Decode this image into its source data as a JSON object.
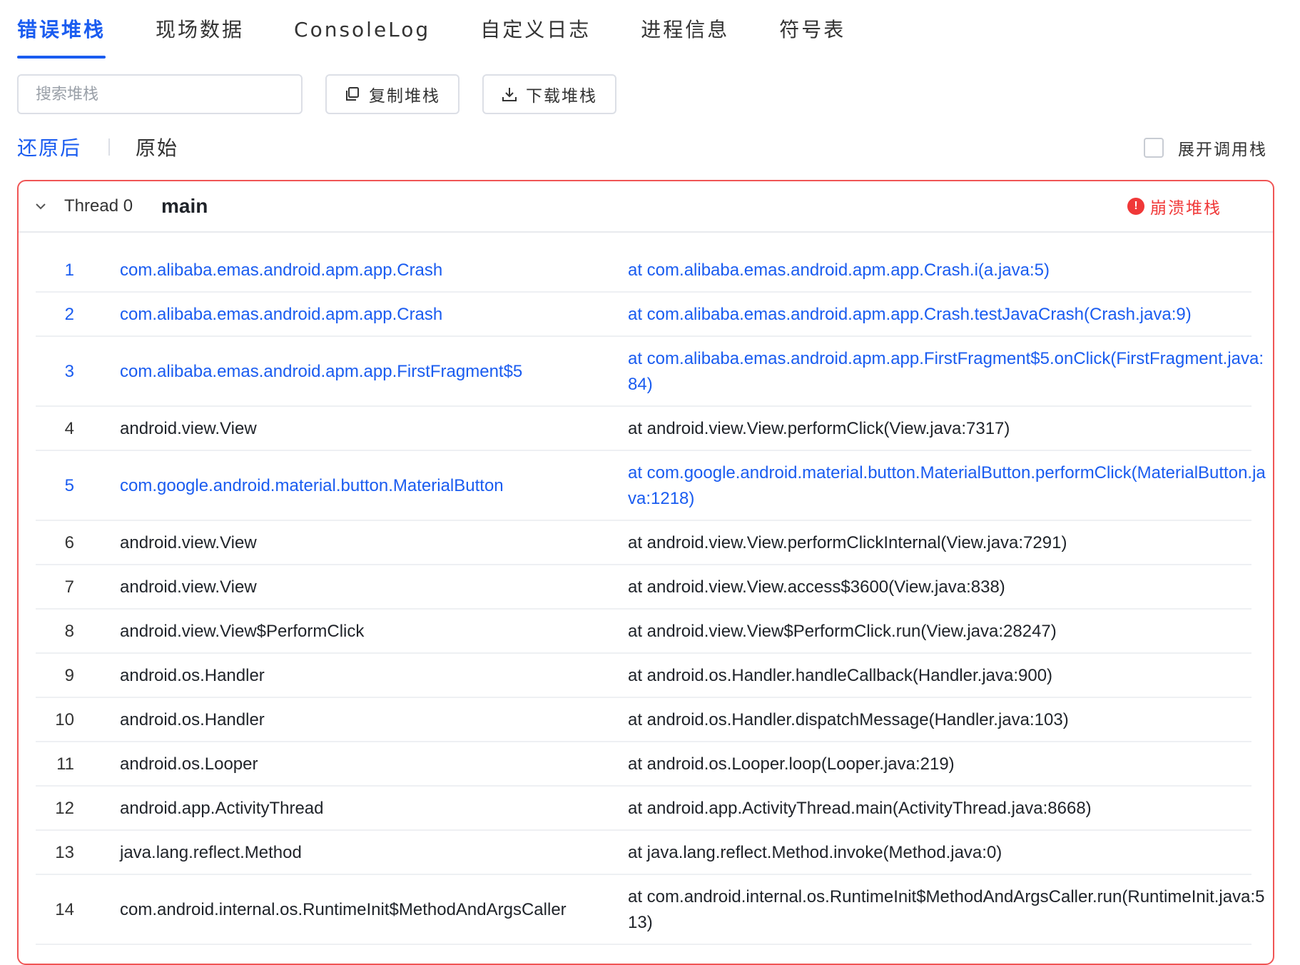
{
  "tabs": [
    {
      "label": "错误堆栈",
      "active": true
    },
    {
      "label": "现场数据",
      "active": false
    },
    {
      "label": "ConsoleLog",
      "active": false
    },
    {
      "label": "自定义日志",
      "active": false
    },
    {
      "label": "进程信息",
      "active": false
    },
    {
      "label": "符号表",
      "active": false
    }
  ],
  "toolbar": {
    "search_placeholder": "搜索堆栈",
    "copy_label": "复制堆栈",
    "download_label": "下载堆栈"
  },
  "view_toggle": {
    "restored_label": "还原后",
    "raw_label": "原始",
    "selected": "还原后"
  },
  "expand_call_stack": {
    "label": "展开调用栈",
    "checked": false
  },
  "thread": {
    "label": "Thread 0",
    "name": "main",
    "crash_label": "崩溃堆栈",
    "crash_icon": "!"
  },
  "colors": {
    "accent": "#1a5cf0",
    "crash": "#f03838",
    "panel_border": "#f05555"
  },
  "frames": [
    {
      "index": "1",
      "cls": "com.alibaba.emas.android.apm.app.Crash",
      "frame": "at com.alibaba.emas.android.apm.app.Crash.i(a.java:5)",
      "highlight": true
    },
    {
      "index": "2",
      "cls": "com.alibaba.emas.android.apm.app.Crash",
      "frame": "at com.alibaba.emas.android.apm.app.Crash.testJavaCrash(Crash.java:9)",
      "highlight": true
    },
    {
      "index": "3",
      "cls": "com.alibaba.emas.android.apm.app.FirstFragment$5",
      "frame": "at com.alibaba.emas.android.apm.app.FirstFragment$5.onClick(FirstFragment.java:84)",
      "highlight": true
    },
    {
      "index": "4",
      "cls": "android.view.View",
      "frame": "at android.view.View.performClick(View.java:7317)",
      "highlight": false
    },
    {
      "index": "5",
      "cls": "com.google.android.material.button.MaterialButton",
      "frame": "at com.google.android.material.button.MaterialButton.performClick(MaterialButton.java:1218)",
      "highlight": true
    },
    {
      "index": "6",
      "cls": "android.view.View",
      "frame": "at android.view.View.performClickInternal(View.java:7291)",
      "highlight": false
    },
    {
      "index": "7",
      "cls": "android.view.View",
      "frame": "at android.view.View.access$3600(View.java:838)",
      "highlight": false
    },
    {
      "index": "8",
      "cls": "android.view.View$PerformClick",
      "frame": "at android.view.View$PerformClick.run(View.java:28247)",
      "highlight": false
    },
    {
      "index": "9",
      "cls": "android.os.Handler",
      "frame": "at android.os.Handler.handleCallback(Handler.java:900)",
      "highlight": false
    },
    {
      "index": "10",
      "cls": "android.os.Handler",
      "frame": "at android.os.Handler.dispatchMessage(Handler.java:103)",
      "highlight": false
    },
    {
      "index": "11",
      "cls": "android.os.Looper",
      "frame": "at android.os.Looper.loop(Looper.java:219)",
      "highlight": false
    },
    {
      "index": "12",
      "cls": "android.app.ActivityThread",
      "frame": "at android.app.ActivityThread.main(ActivityThread.java:8668)",
      "highlight": false
    },
    {
      "index": "13",
      "cls": "java.lang.reflect.Method",
      "frame": "at java.lang.reflect.Method.invoke(Method.java:0)",
      "highlight": false
    },
    {
      "index": "14",
      "cls": "com.android.internal.os.RuntimeInit$MethodAndArgsCaller",
      "frame": "at com.android.internal.os.RuntimeInit$MethodAndArgsCaller.run(RuntimeInit.java:513)",
      "highlight": false
    }
  ]
}
